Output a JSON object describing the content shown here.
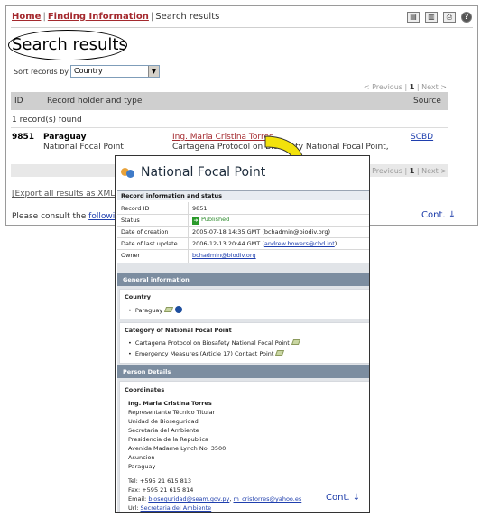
{
  "search_page": {
    "breadcrumb": {
      "home": "Home",
      "sep1": "|",
      "finding": "Finding Information",
      "sep2": "|",
      "current": "Search results"
    },
    "title": "Search results",
    "sort_label": "Sort records by",
    "sort_value": "Country",
    "pager": {
      "previous": "< Previous",
      "sep": "|",
      "page": "1",
      "next": "Next >"
    },
    "columns": {
      "id": "ID",
      "holder": "Record holder and type",
      "source": "Source"
    },
    "found_text": "1 record(s) found",
    "row": {
      "id": "9851",
      "country": "Paraguay",
      "type": "National Focal Point",
      "name": "Ing. Maria Cristina Torres",
      "desc": "Cartagena Protocol on Biosafety National Focal Point,",
      "source": "SCBD"
    },
    "export": "[Export all results as XML]",
    "consult_prefix": "Please consult the",
    "consult_link": "following",
    "cont": "Cont. ↓"
  },
  "detail": {
    "title": "National Focal Point",
    "record_section": "Record information and status",
    "fields": [
      {
        "key": "Record ID",
        "value": "9851"
      },
      {
        "key": "Status",
        "value": "Published"
      },
      {
        "key": "Date of creation",
        "value": "2005-07-18 14:35 GMT (bchadmin@biodiv.org)"
      },
      {
        "key": "Date of last update",
        "prefix": "2006-12-13 20:44 GMT (",
        "link": "andrew.bowers@cbd.int",
        "suffix": ")"
      },
      {
        "key": "Owner",
        "link": "bchadmin@biodiv.org"
      }
    ],
    "general_info": "General information",
    "country_label": "Country",
    "country_value": "Paraguay",
    "category_label": "Category of National Focal Point",
    "categories": [
      "Cartagena Protocol on Biosafety National Focal Point",
      "Emergency Measures (Article 17) Contact Point"
    ],
    "person_details": "Person Details",
    "coordinates_label": "Coordinates",
    "person_name": "Ing. Maria Cristina Torres",
    "address_lines": [
      "Representante Técnico Titular",
      "Unidad de Bioseguridad",
      "Secretaria del Ambiente",
      "Presidencia de la Republica",
      "Avenida Madame Lynch No. 3500",
      "Asuncion",
      "Paraguay"
    ],
    "tel": "Tel: +595 21 615 813",
    "fax": "Fax: +595 21 615 814",
    "email_label": "Email:",
    "email1": "bioseguridad@seam.gov.py",
    "email_sep": ",",
    "email2": "m_cristorres@yahoo.es",
    "url_label": "Url:",
    "url": "Secretaria del Ambiente",
    "cont": "Cont. ↓"
  },
  "colors": {
    "link_red": "#a4292e",
    "link_blue": "#1f3fae",
    "band": "#7c8da0",
    "arrow": "#f2e20c"
  }
}
